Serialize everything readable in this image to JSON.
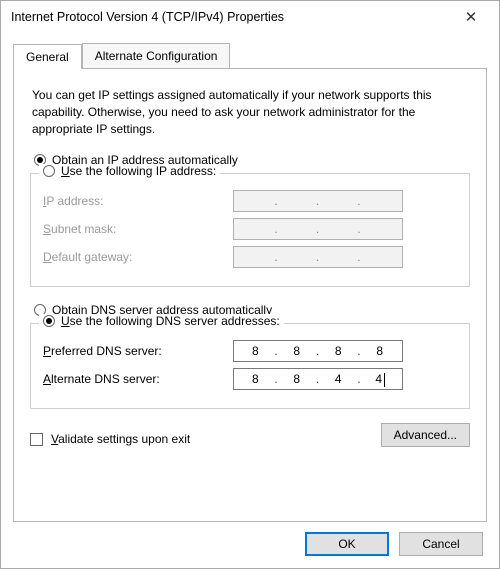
{
  "window": {
    "title": "Internet Protocol Version 4 (TCP/IPv4) Properties",
    "close_glyph": "✕"
  },
  "tabs": {
    "general": "General",
    "alternate": "Alternate Configuration"
  },
  "intro": "You can get IP settings assigned automatically if your network supports this capability. Otherwise, you need to ask your network administrator for the appropriate IP settings.",
  "ip": {
    "auto_label_pre": "O",
    "auto_label_rest": "btain an IP address automatically",
    "manual_label_pre": "U",
    "manual_label_rest": "se the following IP address:",
    "addr_label_pre": "I",
    "addr_label_rest": "P address:",
    "mask_label_pre": "S",
    "mask_label_rest": "ubnet mask:",
    "gateway_label_pre": "D",
    "gateway_label_rest": "efault gateway:"
  },
  "dns": {
    "auto_label_pre": "O",
    "auto_label_rest": "btain DNS server address automatically",
    "manual_label_pre": "U",
    "manual_label_rest": "se the following DNS server addresses:",
    "pref_label_pre": "P",
    "pref_label_rest": "referred DNS server:",
    "alt_label_pre": "A",
    "alt_label_rest": "lternate DNS server:",
    "preferred": {
      "o1": "8",
      "o2": "8",
      "o3": "8",
      "o4": "8"
    },
    "alternate": {
      "o1": "8",
      "o2": "8",
      "o3": "4",
      "o4": "4"
    }
  },
  "validate_label_pre": "V",
  "validate_label_rest": "alidate settings upon exit",
  "advanced_label": "Advanced...",
  "ok_label": "OK",
  "cancel_label": "Cancel"
}
